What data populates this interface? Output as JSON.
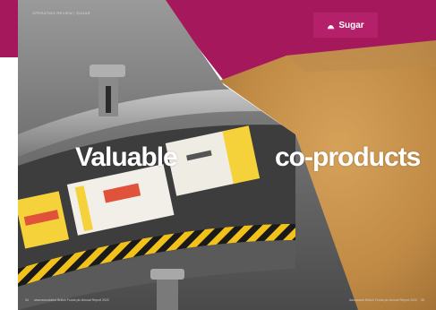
{
  "page": {
    "section_label": "OPERATING REVIEW | SUGAR",
    "tab_label": "Sugar",
    "tab_icon": "sugar-icon",
    "headline_left": "Valuable",
    "headline_right": "co-products",
    "footer_left": "www.associated British Foods plc Annual Report 2022",
    "footer_right": "Associated British Foods plc Annual Report 2022",
    "page_left": "34",
    "page_right": "35"
  },
  "colors": {
    "magenta": "#a5195c",
    "tab": "#b4206a",
    "sugar_beet_pulp": "#c8924a",
    "hazard_yellow": "#f2c21a",
    "package_yellow": "#f5d23a"
  }
}
